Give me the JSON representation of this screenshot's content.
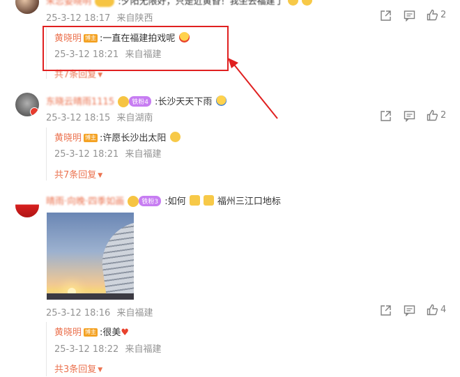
{
  "comments": [
    {
      "id": "c1",
      "author": "朱恋姿晓明",
      "text": ":夕阳无限好，只是近黄昏！我坐去福建了",
      "time": "25-3-12 18:17",
      "location": "来自陕西",
      "likes": "2",
      "reply": {
        "author": "黄晓明",
        "author_tag": "博主",
        "text": ":一直在福建拍戏呢",
        "time": "25-3-12 18:21",
        "location": "来自福建"
      },
      "more_replies": "共7条回复"
    },
    {
      "id": "c2",
      "author": "东晓云晴雨1115",
      "badge": "铁粉4",
      "text": ":长沙天天下雨",
      "time": "25-3-12 18:15",
      "location": "来自湖南",
      "likes": "2",
      "reply": {
        "author": "黄晓明",
        "author_tag": "博主",
        "text": ":许愿长沙出太阳",
        "time": "25-3-12 18:21",
        "location": "来自福建"
      },
      "more_replies": "共7条回复"
    },
    {
      "id": "c3",
      "author": "晴雨·向晚·四季如画",
      "badge": "铁粉3",
      "text": ":如何",
      "text2": "福州三江口地标",
      "time": "25-3-12 18:16",
      "location": "来自福建",
      "likes": "4",
      "reply": {
        "author": "黄晓明",
        "author_tag": "博主",
        "text": ":很美",
        "time": "25-3-12 18:22",
        "location": "来自福建"
      },
      "more_replies": "共3条回复"
    }
  ],
  "colors": {
    "accent": "#eb7350",
    "meta": "#939393",
    "highlight": "#e02020",
    "author_tag": "#f4a223"
  },
  "icons": [
    "share-icon",
    "comment-icon",
    "like-icon",
    "red-arrow"
  ]
}
